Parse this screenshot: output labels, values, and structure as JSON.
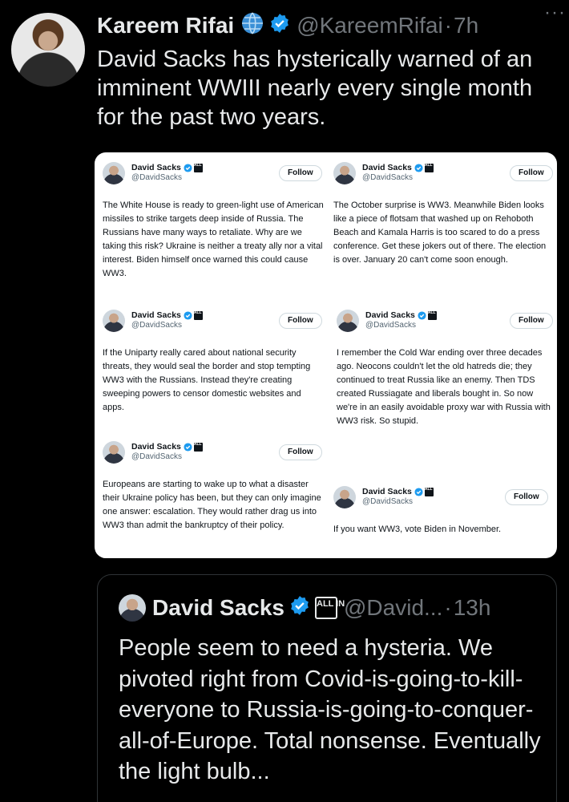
{
  "tweet": {
    "author_name": "Kareem Rifai",
    "handle": "@KareemRifai",
    "separator": "·",
    "time": "7h",
    "more_label": "···",
    "text": "David Sacks has hysterically warned of an imminent WWIII nearly every single month for the past two years."
  },
  "media": {
    "posts": [
      {
        "name": "David Sacks",
        "handle": "@DavidSacks",
        "follow_label": "Follow",
        "text": "The White House is ready to green-light use of American missiles to strike targets deep inside of Russia. The Russians have many ways to retaliate. Why are we taking this risk? Ukraine is neither a treaty ally nor a vital interest. Biden himself once warned this could cause WW3."
      },
      {
        "name": "David Sacks",
        "handle": "@DavidSacks",
        "follow_label": "Follow",
        "text": "The October surprise is WW3. Meanwhile Biden looks like a piece of flotsam that washed up on Rehoboth Beach and Kamala Harris is too scared to do a press conference. Get these jokers out of there. The election is over. January 20 can't come soon enough."
      },
      {
        "name": "David Sacks",
        "handle": "@DavidSacks",
        "follow_label": "Follow",
        "text": "If the Uniparty really cared about national security threats, they would seal the border and stop tempting WW3 with the Russians. Instead they're creating sweeping powers to censor domestic websites and apps."
      },
      {
        "name": "David Sacks",
        "handle": "@DavidSacks",
        "follow_label": "Follow",
        "text": "I remember the Cold War ending over three decades ago. Neocons couldn't let the old hatreds die; they continued to treat Russia like an enemy. Then TDS created Russiagate and liberals bought in. So now we're in an easily avoidable proxy war with Russia with WW3 risk. So stupid."
      },
      {
        "name": "David Sacks",
        "handle": "@DavidSacks",
        "follow_label": "Follow",
        "text": "Europeans are starting to wake up to what a disaster their Ukraine policy has been, but they can only imagine one answer: escalation. They would rather drag us into WW3 than admit the bankruptcy of their policy."
      },
      {
        "name": "David Sacks",
        "handle": "@DavidSacks",
        "follow_label": "Follow",
        "text": "If you want WW3, vote Biden in November."
      }
    ],
    "allin_badge": "ALL IN"
  },
  "quote": {
    "author_name": "David Sacks",
    "badge": "ALL IN",
    "handle": "@David...",
    "separator": "·",
    "time": "13h",
    "text": "People seem to need a hysteria. We pivoted right from Covid-is-going-to-kill-everyone to Russia-is-going-to-conquer-all-of-Europe. Total nonsense. Eventually the light bulb..."
  },
  "colors": {
    "background": "#000000",
    "verified": "#1d9bf0",
    "muted": "#71767b",
    "text": "#e7e9ea"
  },
  "icons": [
    "globe-icon",
    "verified-badge-icon",
    "more-icon",
    "allin-badge-icon"
  ]
}
